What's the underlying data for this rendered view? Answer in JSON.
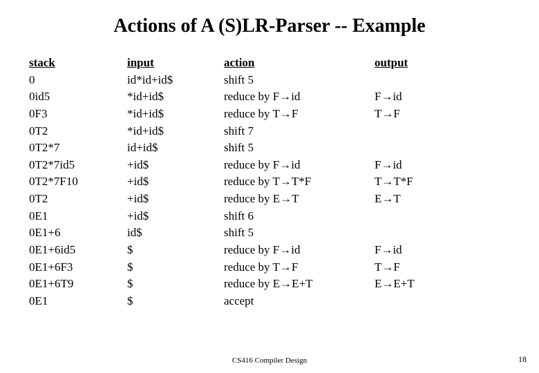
{
  "title": "Actions of A (S)LR-Parser -- Example",
  "headers": {
    "stack": "stack",
    "input": "input",
    "action": "action",
    "output": "output"
  },
  "rows": [
    {
      "stack": "0",
      "input": "id*id+id$",
      "action": "shift 5",
      "output": ""
    },
    {
      "stack": "0id5",
      "input": "*id+id$",
      "action": "reduce by F→id",
      "output": "F→id"
    },
    {
      "stack": "0F3",
      "input": "*id+id$",
      "action": "reduce by T→F",
      "output": "T→F"
    },
    {
      "stack": "0T2",
      "input": "*id+id$",
      "action": "shift 7",
      "output": ""
    },
    {
      "stack": "0T2*7",
      "input": "id+id$",
      "action": "shift 5",
      "output": ""
    },
    {
      "stack": "0T2*7id5",
      "input": "+id$",
      "action": "reduce by F→id",
      "output": "F→id"
    },
    {
      "stack": "0T2*7F10",
      "input": "+id$",
      "action": "reduce by T→T*F",
      "output": "T→T*F"
    },
    {
      "stack": "0T2",
      "input": "+id$",
      "action": "reduce by E→T",
      "output": "E→T"
    },
    {
      "stack": "0E1",
      "input": "+id$",
      "action": "shift 6",
      "output": ""
    },
    {
      "stack": "0E1+6",
      "input": "id$",
      "action": "shift 5",
      "output": ""
    },
    {
      "stack": "0E1+6id5",
      "input": "$",
      "action": "reduce by F→id",
      "output": "F→id"
    },
    {
      "stack": "0E1+6F3",
      "input": "$",
      "action": "reduce by T→F",
      "output": "T→F"
    },
    {
      "stack": "0E1+6T9",
      "input": "$",
      "action": "reduce by E→E+T",
      "output": "E→E+T"
    },
    {
      "stack": "0E1",
      "input": "$",
      "action": "accept",
      "output": ""
    }
  ],
  "footer": "CS416 Compiler Design",
  "pagenum": "18"
}
